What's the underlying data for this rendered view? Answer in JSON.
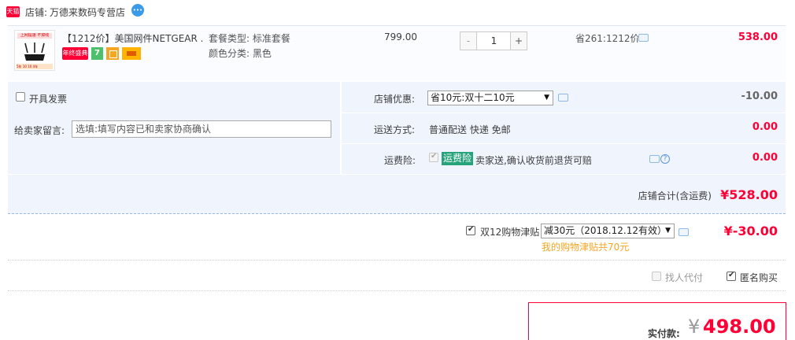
{
  "store": {
    "badge": "天猫",
    "label": "店铺:",
    "name": "万德来数码专营店",
    "chat_icon": "wangwang-chat-icon"
  },
  "item": {
    "thumb_top": "上网提速 不掉线",
    "thumb_bottom": "5年 10 10 4年",
    "title": "【1212价】美国网件NETGEAR ...",
    "promo_tag": "年终盛典",
    "seven_tag": "7",
    "sku_type_label": "套餐类型:",
    "sku_type_value": "标准套餐",
    "sku_color_label": "颜色分类:",
    "sku_color_value": "黑色",
    "unit_price": "799.00",
    "qty_minus": "-",
    "quantity": "1",
    "qty_plus": "+",
    "saving": "省261:1212价",
    "total": "538.00"
  },
  "options": {
    "invoice_label": "开具发票",
    "invoice_checked": false,
    "memo_label": "给卖家留言:",
    "memo_placeholder": "选填:填写内容已和卖家协商确认",
    "discount_label": "店铺优惠:",
    "discount_value": "省10元:双十二10元",
    "discount_amount": "-10.00",
    "shipping_label": "运送方式:",
    "shipping_value": "普通配送 快递 免邮",
    "shipping_amount": "0.00",
    "insurance_label": "运费险:",
    "insurance_badge": "运费险",
    "insurance_text": "卖家送,确认收货前退货可赔",
    "insurance_checked": true,
    "insurance_amount": "0.00"
  },
  "subtotal": {
    "label": "店铺合计(含运费)",
    "value": "¥528.00"
  },
  "allowance": {
    "label": "双12购物津贴",
    "checked": true,
    "select_value": "减30元（2018.12.12有效）",
    "note": "我的购物津贴共70元",
    "amount": "¥-30.00"
  },
  "purchase": {
    "proxy_label": "找人代付",
    "anonymous_label": "匿名购买",
    "anonymous_checked": true
  },
  "payment": {
    "label": "实付款:",
    "currency": "¥",
    "amount": "498.00"
  },
  "colors": {
    "accent": "#ff0036",
    "panel": "#eff4fd",
    "insurance": "#26a37a",
    "note": "#f5a623"
  }
}
